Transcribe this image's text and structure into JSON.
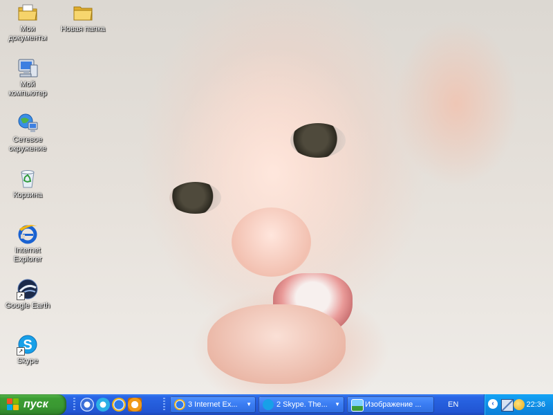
{
  "desktop": {
    "icons": [
      {
        "label": "Мои документы",
        "icon": "my-documents-folder-icon"
      },
      {
        "label": "Новая папка",
        "icon": "folder-icon"
      },
      {
        "label": "Мой компьютер",
        "icon": "my-computer-icon"
      },
      {
        "label": "Сетевое окружение",
        "icon": "network-places-icon"
      },
      {
        "label": "Корзина",
        "icon": "recycle-bin-icon"
      },
      {
        "label": "Internet Explorer",
        "icon": "internet-explorer-icon"
      },
      {
        "label": "Google Earth",
        "icon": "google-earth-icon"
      },
      {
        "label": "Skype",
        "icon": "skype-icon"
      }
    ]
  },
  "taskbar": {
    "start_label": "пуск",
    "quick_launch": [
      "browser-icon",
      "media-player-icon",
      "internet-explorer-icon",
      "clock-app-icon"
    ],
    "tasks": [
      {
        "label": "3 Internet Ex...",
        "icon": "internet-explorer-icon",
        "grouped": true
      },
      {
        "label": "2 Skype. The...",
        "icon": "skype-icon",
        "grouped": true
      },
      {
        "label": "Изображение ...",
        "icon": "image-viewer-icon",
        "grouped": false
      }
    ],
    "language": "EN",
    "clock": "22:36"
  }
}
